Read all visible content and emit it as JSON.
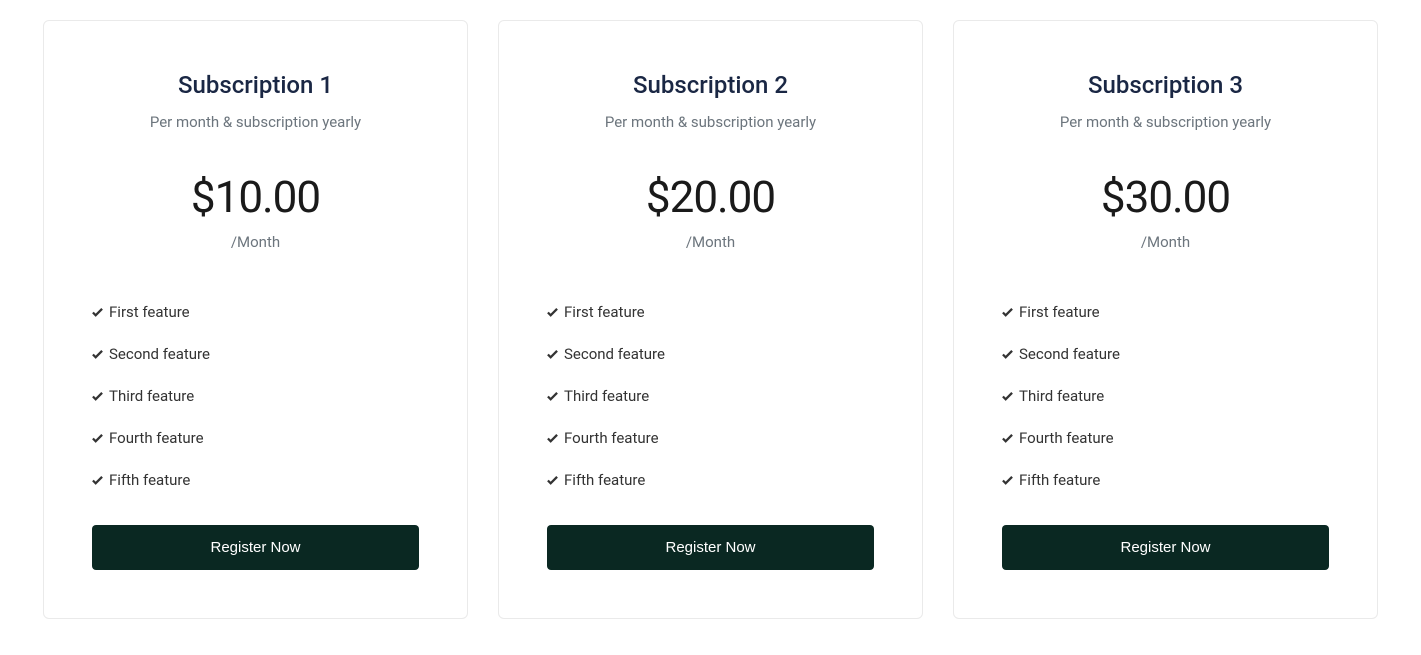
{
  "plans": [
    {
      "title": "Subscription 1",
      "subtitle": "Per month & subscription yearly",
      "price": "$10.00",
      "period": "/Month",
      "features": [
        "First feature",
        "Second feature",
        "Third feature",
        "Fourth feature",
        "Fifth feature"
      ],
      "button": "Register Now"
    },
    {
      "title": "Subscription 2",
      "subtitle": "Per month & subscription yearly",
      "price": "$20.00",
      "period": "/Month",
      "features": [
        "First feature",
        "Second feature",
        "Third feature",
        "Fourth feature",
        "Fifth feature"
      ],
      "button": "Register Now"
    },
    {
      "title": "Subscription 3",
      "subtitle": "Per month & subscription yearly",
      "price": "$30.00",
      "period": "/Month",
      "features": [
        "First feature",
        "Second feature",
        "Third feature",
        "Fourth feature",
        "Fifth feature"
      ],
      "button": "Register Now"
    }
  ]
}
